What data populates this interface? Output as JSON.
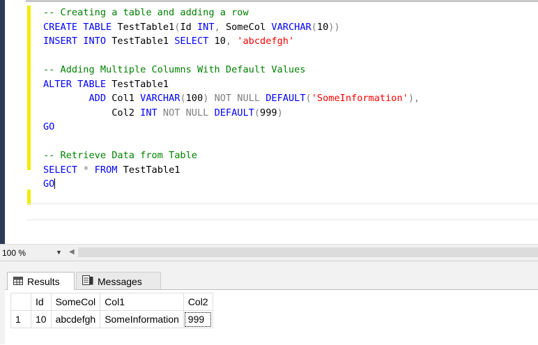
{
  "editor": {
    "lines": [
      [
        {
          "t": "-- Creating a table and adding a row",
          "c": "cmt"
        }
      ],
      [
        {
          "t": "CREATE TABLE",
          "c": "kw"
        },
        {
          "t": " TestTable1",
          "c": ""
        },
        {
          "t": "(",
          "c": "op"
        },
        {
          "t": "Id ",
          "c": ""
        },
        {
          "t": "INT",
          "c": "kw"
        },
        {
          "t": ", ",
          "c": "op"
        },
        {
          "t": "SomeCol ",
          "c": ""
        },
        {
          "t": "VARCHAR",
          "c": "kw"
        },
        {
          "t": "(",
          "c": "op"
        },
        {
          "t": "10",
          "c": ""
        },
        {
          "t": "))",
          "c": "op"
        }
      ],
      [
        {
          "t": "INSERT INTO",
          "c": "kw"
        },
        {
          "t": " TestTable1 ",
          "c": ""
        },
        {
          "t": "SELECT",
          "c": "kw"
        },
        {
          "t": " 10",
          "c": ""
        },
        {
          "t": ", ",
          "c": "op"
        },
        {
          "t": "'abcdefgh'",
          "c": "str"
        }
      ],
      [],
      [
        {
          "t": "-- Adding Multiple Columns With Default Values",
          "c": "cmt"
        }
      ],
      [
        {
          "t": "ALTER TABLE",
          "c": "kw"
        },
        {
          "t": " TestTable1",
          "c": ""
        }
      ],
      [
        {
          "t": "        ADD",
          "c": "kw"
        },
        {
          "t": " Col1 ",
          "c": ""
        },
        {
          "t": "VARCHAR",
          "c": "kw"
        },
        {
          "t": "(",
          "c": "op"
        },
        {
          "t": "100",
          "c": ""
        },
        {
          "t": ") ",
          "c": "op"
        },
        {
          "t": "NOT NULL",
          "c": "op"
        },
        {
          "t": " ",
          "c": ""
        },
        {
          "t": "DEFAULT",
          "c": "kw"
        },
        {
          "t": "(",
          "c": "op"
        },
        {
          "t": "'SomeInformation'",
          "c": "str"
        },
        {
          "t": "),",
          "c": "op"
        }
      ],
      [
        {
          "t": "            Col2 ",
          "c": ""
        },
        {
          "t": "INT",
          "c": "kw"
        },
        {
          "t": " ",
          "c": ""
        },
        {
          "t": "NOT NULL",
          "c": "op"
        },
        {
          "t": " ",
          "c": ""
        },
        {
          "t": "DEFAULT",
          "c": "kw"
        },
        {
          "t": "(",
          "c": "op"
        },
        {
          "t": "999",
          "c": ""
        },
        {
          "t": ")",
          "c": "op"
        }
      ],
      [
        {
          "t": "GO",
          "c": "kw"
        }
      ],
      [],
      [
        {
          "t": "-- Retrieve Data from Table",
          "c": "cmt"
        }
      ],
      [
        {
          "t": "SELECT",
          "c": "kw"
        },
        {
          "t": " * ",
          "c": "op"
        },
        {
          "t": "FROM",
          "c": "kw"
        },
        {
          "t": " TestTable1",
          "c": ""
        }
      ],
      [
        {
          "t": "GO",
          "c": "kw"
        }
      ]
    ]
  },
  "zoom": {
    "value": "100 %",
    "dropdown_icon": "chevron-down-icon",
    "scroll_icon": "scroll-left-icon"
  },
  "results": {
    "tabs": [
      {
        "label": "Results",
        "icon": "grid-icon"
      },
      {
        "label": "Messages",
        "icon": "messages-icon"
      }
    ],
    "columns": [
      "Id",
      "SomeCol",
      "Col1",
      "Col2"
    ],
    "rows": [
      {
        "num": "1",
        "cells": [
          "10",
          "abcdefgh",
          "SomeInformation",
          "999"
        ]
      }
    ]
  }
}
